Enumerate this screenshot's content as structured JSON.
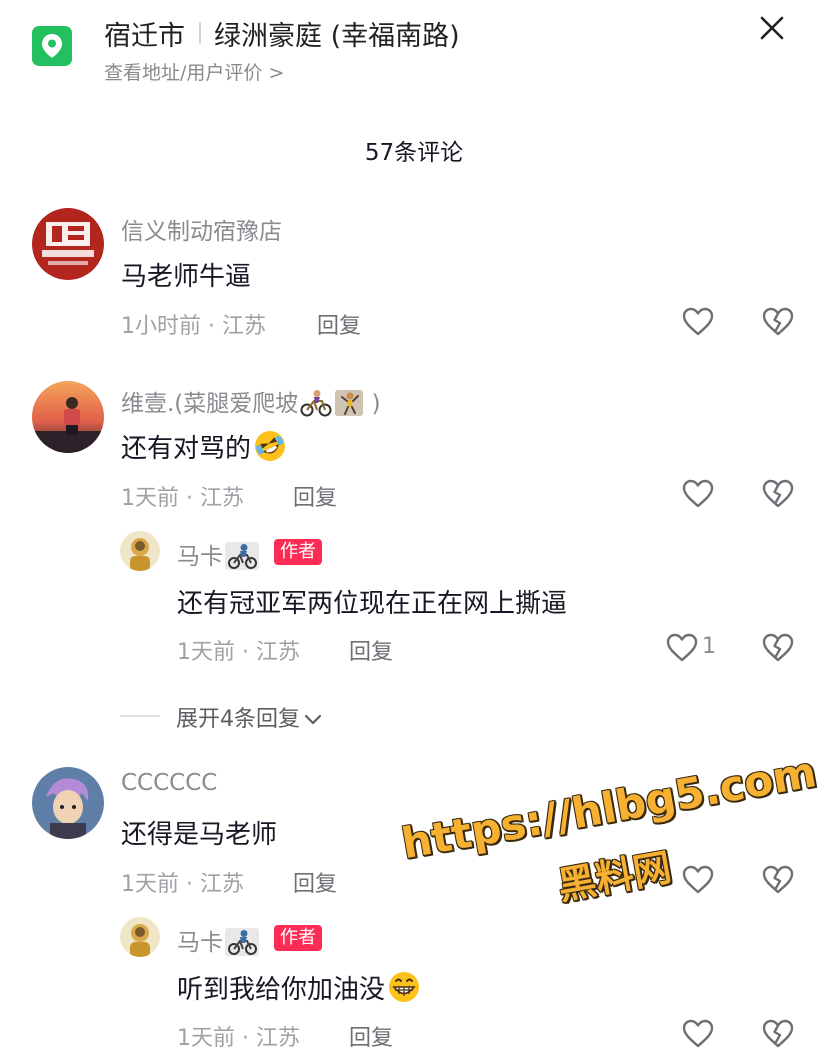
{
  "header": {
    "city": "宿迁市",
    "place": "绿洲豪庭 (幸福南路)",
    "sublink": "查看地址/用户评价 >"
  },
  "comments_count": "57条评论",
  "comments": [
    {
      "username": "信义制动宿豫店",
      "text": "马老师牛逼",
      "meta": "1小时前 · 江苏",
      "reply_label": "回复"
    },
    {
      "username": "维壹.(菜腿爱爬坡",
      "username_suffix": ")",
      "text": "还有对骂的",
      "meta": "1天前 · 江苏",
      "reply_label": "回复",
      "replies": [
        {
          "username": "马卡",
          "badge": "作者",
          "text": "还有冠亚军两位现在正在网上撕逼",
          "meta": "1天前 · 江苏",
          "reply_label": "回复",
          "likes": "1"
        }
      ],
      "expand_label": "展开4条回复"
    },
    {
      "username": "CCCCCC",
      "text": "还得是马老师",
      "meta": "1天前 · 江苏",
      "reply_label": "回复",
      "replies": [
        {
          "username": "马卡",
          "badge": "作者",
          "text": "听到我给你加油没",
          "meta": "1天前 · 江苏",
          "reply_label": "回复"
        }
      ]
    }
  ],
  "watermark": {
    "url": "https://hlbg5.com",
    "site": "黑料网"
  },
  "colors": {
    "location_icon": "#22c05f",
    "author_badge": "#fe2c55",
    "watermark": "#f6b032"
  },
  "icons": [
    "location-pin-icon",
    "close-icon",
    "heart-icon",
    "broken-heart-icon",
    "chevron-down-icon",
    "cyclist-emoji",
    "climber-emoji",
    "rofl-emoji",
    "grin-emoji"
  ]
}
